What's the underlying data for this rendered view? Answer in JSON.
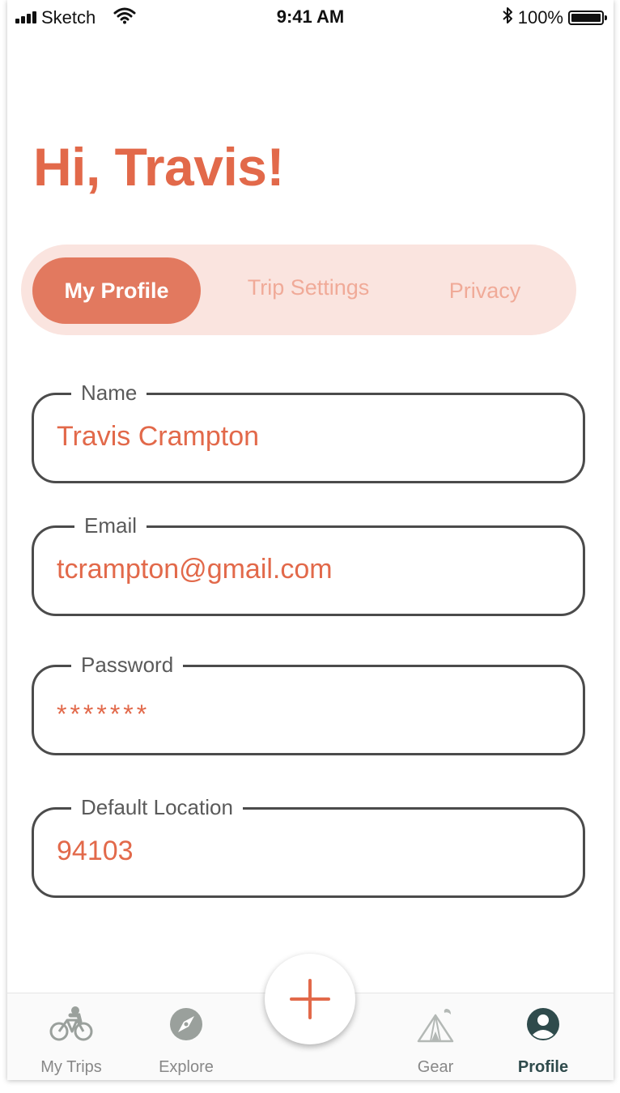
{
  "status_bar": {
    "carrier": "Sketch",
    "time": "9:41 AM",
    "battery": "100%"
  },
  "greeting": "Hi, Travis!",
  "tabs": [
    {
      "label": "My Profile",
      "active": true
    },
    {
      "label": "Trip Settings",
      "active": false
    },
    {
      "label": "Privacy",
      "active": false
    }
  ],
  "fields": {
    "name": {
      "label": "Name",
      "value": "Travis Crampton"
    },
    "email": {
      "label": "Email",
      "value": "tcrampton@gmail.com"
    },
    "password": {
      "label": "Password",
      "value": "*******"
    },
    "location": {
      "label": "Default Location",
      "value": "94103"
    }
  },
  "nav": {
    "my_trips": "My Trips",
    "explore": "Explore",
    "gear": "Gear",
    "profile": "Profile"
  },
  "icons": {
    "fab": "plus-icon",
    "my_trips": "bicycle-icon",
    "explore": "compass-icon",
    "gear": "tent-icon",
    "profile": "user-circle-icon"
  },
  "colors": {
    "accent": "#e2694a",
    "tab_background": "#fae4df",
    "active_tab": "#e2795f",
    "inactive_tab_text": "#f0aa98",
    "nav_active": "#2f4b4c"
  }
}
